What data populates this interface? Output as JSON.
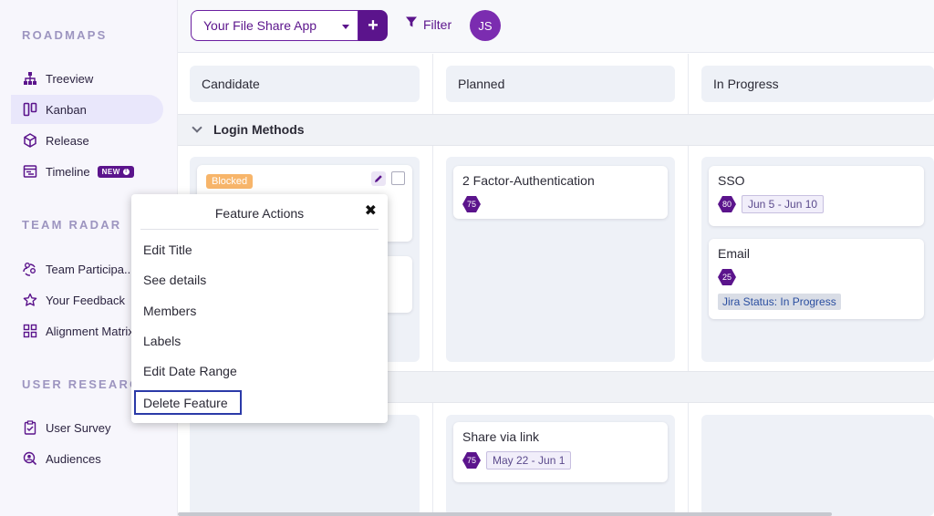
{
  "sidebar": {
    "sections": [
      {
        "title": "ROADMAPS",
        "items": [
          {
            "label": "Treeview",
            "icon": "tree-icon",
            "active": false
          },
          {
            "label": "Kanban",
            "icon": "kanban-icon",
            "active": true
          },
          {
            "label": "Release",
            "icon": "cube-icon",
            "active": false
          },
          {
            "label": "Timeline",
            "icon": "timeline-icon",
            "active": false,
            "badge": "NEW"
          }
        ]
      },
      {
        "title": "TEAM RADAR",
        "items": [
          {
            "label": "Team Participa...",
            "icon": "team-icon"
          },
          {
            "label": "Your Feedback",
            "icon": "star-icon"
          },
          {
            "label": "Alignment Matrix",
            "icon": "grid-icon"
          }
        ]
      },
      {
        "title": "USER RESEARCH",
        "items": [
          {
            "label": "User Survey",
            "icon": "clipboard-check-icon"
          },
          {
            "label": "Audiences",
            "icon": "user-search-icon"
          }
        ]
      }
    ]
  },
  "topbar": {
    "app_select_value": "Your File Share App",
    "add_label": "+",
    "filter_label": "Filter",
    "avatar_initials": "JS"
  },
  "board": {
    "columns": [
      {
        "title": "Candidate"
      },
      {
        "title": "Planned"
      },
      {
        "title": "In Progress"
      }
    ],
    "group_title": "Login Methods",
    "cards": {
      "candidate_blocked": {
        "tag": "Blocked"
      },
      "planned_2fa": {
        "title": "2 Factor-Authentication",
        "score": "75"
      },
      "progress_sso": {
        "title": "SSO",
        "score": "80",
        "date": "Jun 5 - Jun 10"
      },
      "progress_email": {
        "title": "Email",
        "score": "25",
        "jira": "Jira Status: In Progress"
      },
      "planned_share": {
        "title": "Share via link",
        "score": "75",
        "date": "May 22 - Jun 1"
      }
    }
  },
  "popup": {
    "title": "Feature Actions",
    "close_glyph": "✖",
    "items": [
      "Edit Title",
      "See details",
      "Members",
      "Labels",
      "Edit Date Range",
      "Delete Feature"
    ]
  },
  "colors": {
    "brand": "#5b148c",
    "sidebar_bg": "#f7f6fc",
    "lane_bg": "#eef1f7",
    "blocked": "#f7b56a",
    "focus": "#2b3aa8"
  }
}
